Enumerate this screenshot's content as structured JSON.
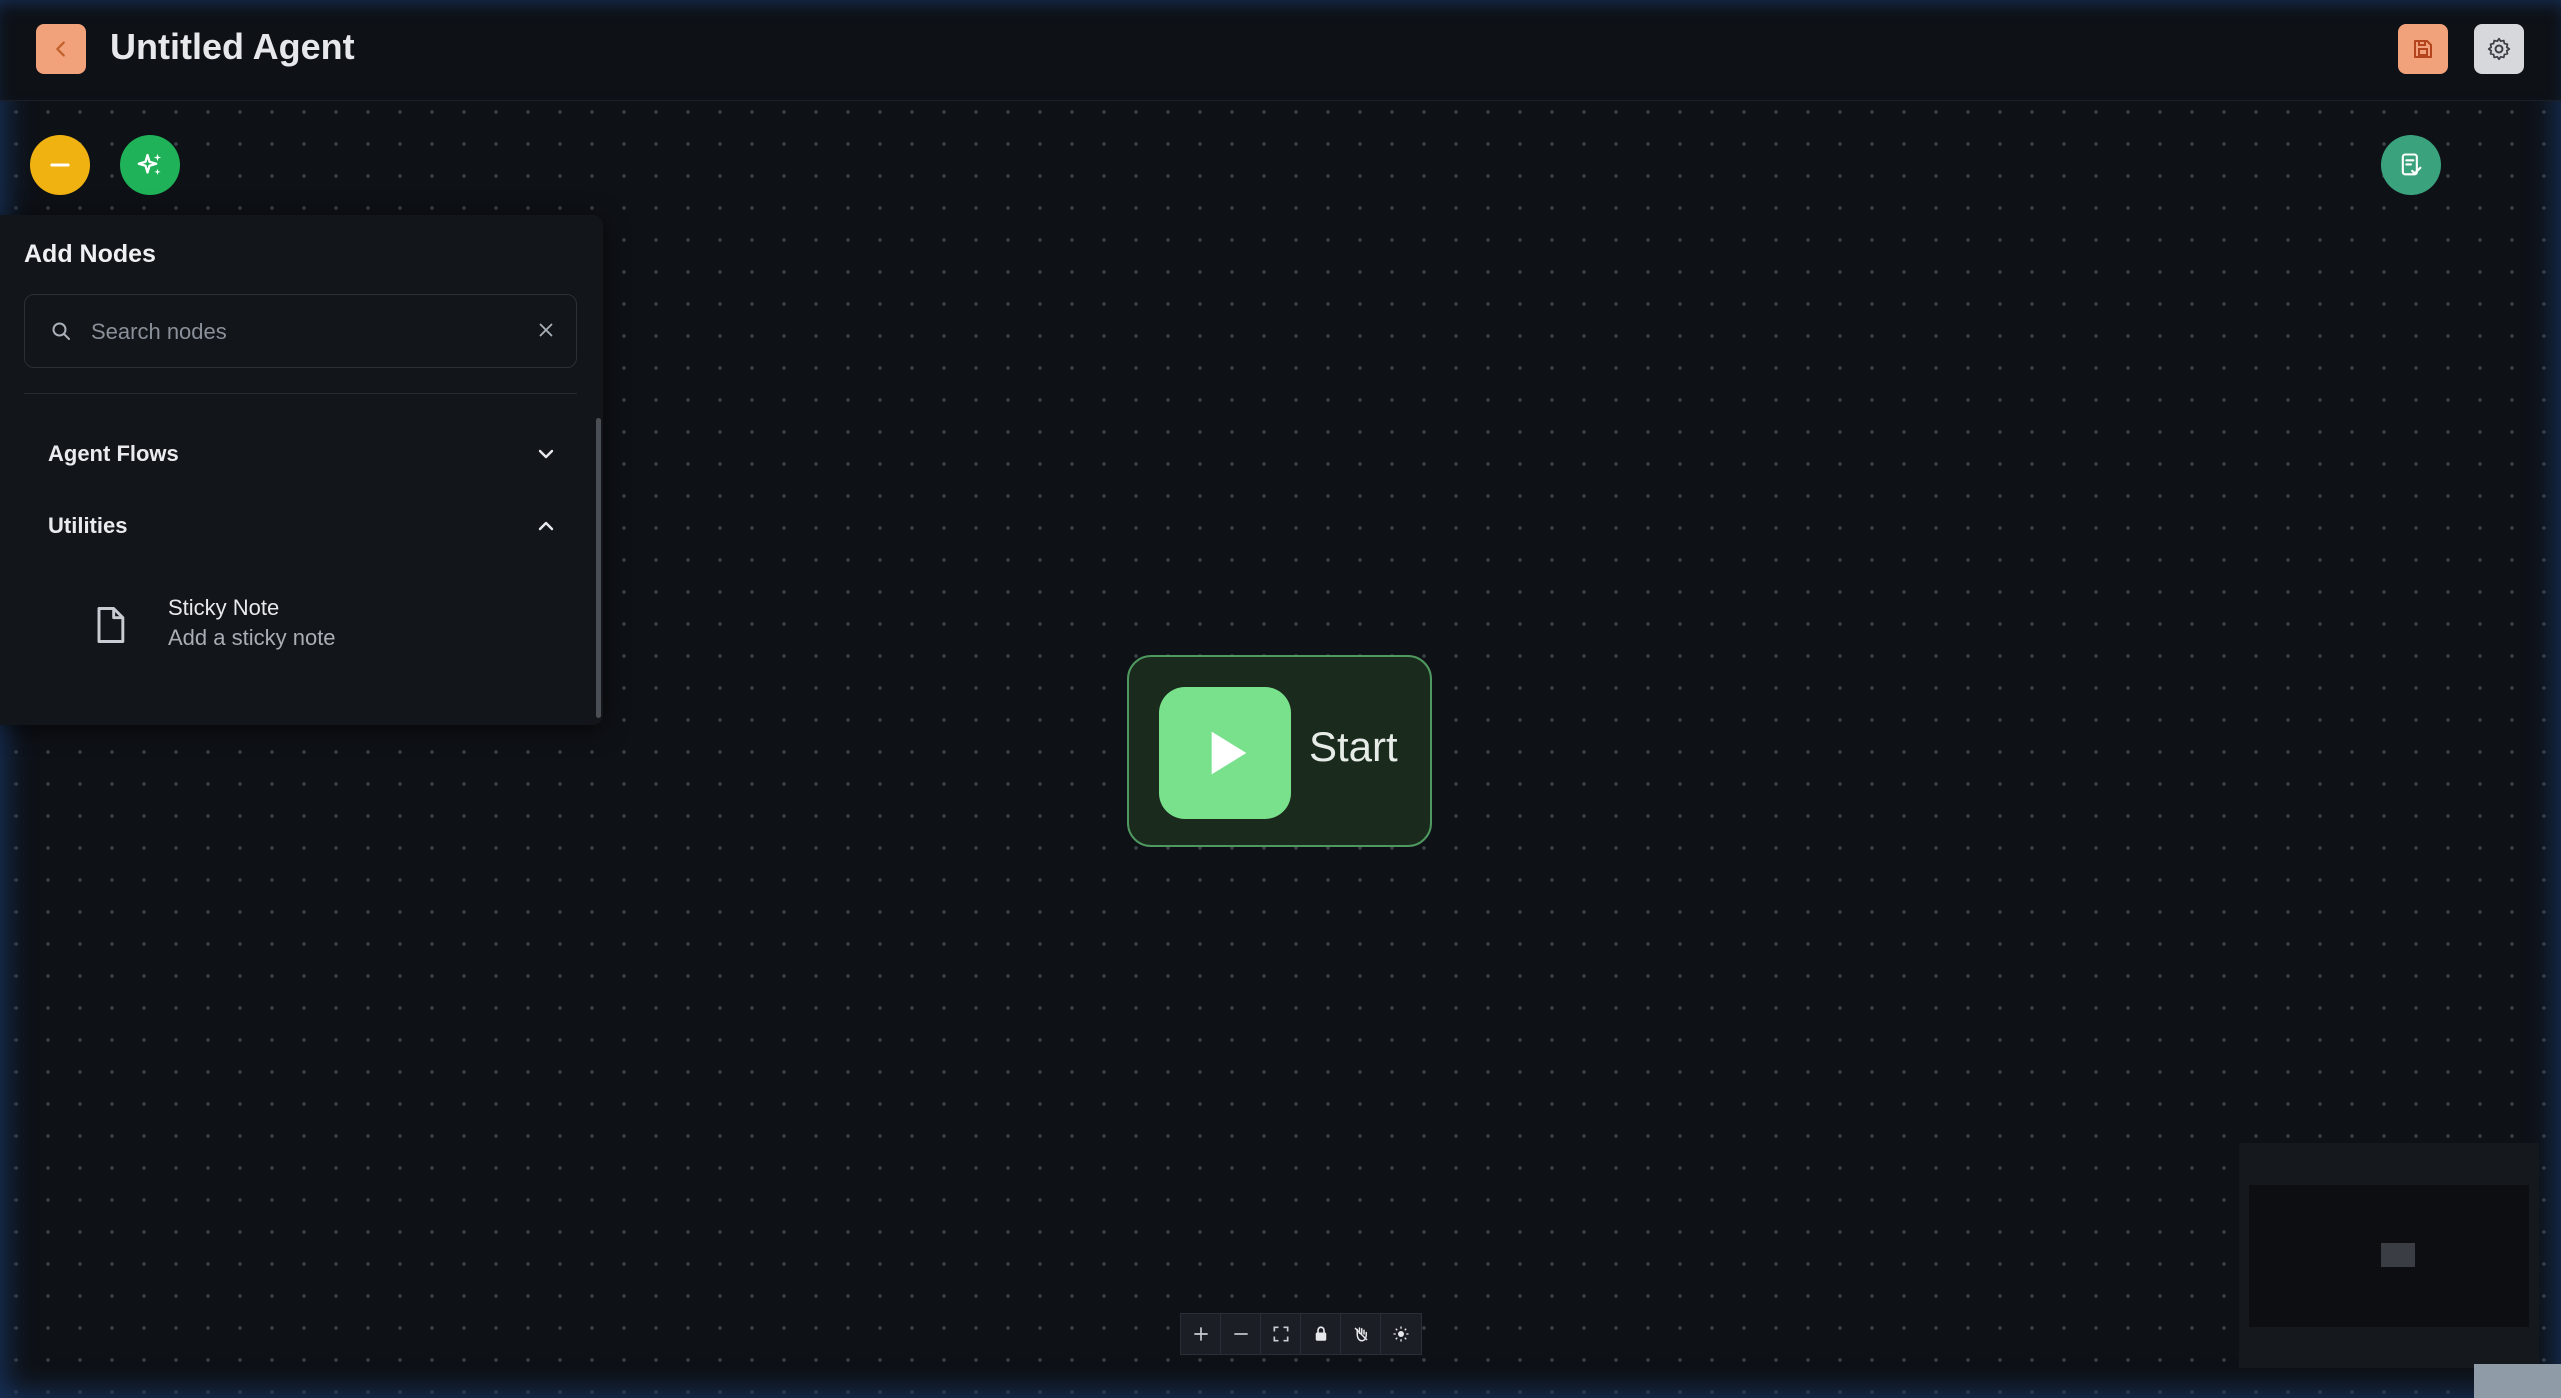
{
  "header": {
    "title": "Untitled Agent"
  },
  "nodes_panel": {
    "title": "Add Nodes",
    "search": {
      "value": "",
      "placeholder": "Search nodes"
    },
    "sections": [
      {
        "label": "Agent Flows",
        "expanded": false
      },
      {
        "label": "Utilities",
        "expanded": true
      }
    ],
    "utility_items": [
      {
        "name": "Sticky Note",
        "description": "Add a sticky note",
        "icon": "file-icon"
      }
    ]
  },
  "canvas": {
    "start_node": {
      "label": "Start",
      "icon": "play-icon"
    }
  },
  "controls": [
    "zoom-in",
    "zoom-out",
    "fit-view",
    "lock",
    "pan-mode",
    "theme"
  ],
  "colors": {
    "back_button": "#f2a27a",
    "save_button": "#f2a27a",
    "collapse_button": "#f0b211",
    "ai_button": "#1fb259",
    "validate_button": "#3aa37e",
    "start_node_border": "#4f9960",
    "start_icon": "#79e08c"
  }
}
